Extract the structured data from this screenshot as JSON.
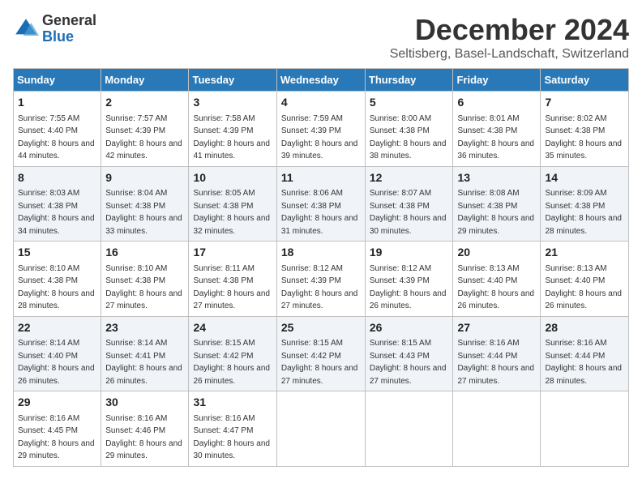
{
  "logo": {
    "general": "General",
    "blue": "Blue"
  },
  "title": "December 2024",
  "subtitle": "Seltisberg, Basel-Landschaft, Switzerland",
  "days_header": [
    "Sunday",
    "Monday",
    "Tuesday",
    "Wednesday",
    "Thursday",
    "Friday",
    "Saturday"
  ],
  "weeks": [
    [
      {
        "day": "1",
        "sunrise": "7:55 AM",
        "sunset": "4:40 PM",
        "daylight": "8 hours and 44 minutes."
      },
      {
        "day": "2",
        "sunrise": "7:57 AM",
        "sunset": "4:39 PM",
        "daylight": "8 hours and 42 minutes."
      },
      {
        "day": "3",
        "sunrise": "7:58 AM",
        "sunset": "4:39 PM",
        "daylight": "8 hours and 41 minutes."
      },
      {
        "day": "4",
        "sunrise": "7:59 AM",
        "sunset": "4:39 PM",
        "daylight": "8 hours and 39 minutes."
      },
      {
        "day": "5",
        "sunrise": "8:00 AM",
        "sunset": "4:38 PM",
        "daylight": "8 hours and 38 minutes."
      },
      {
        "day": "6",
        "sunrise": "8:01 AM",
        "sunset": "4:38 PM",
        "daylight": "8 hours and 36 minutes."
      },
      {
        "day": "7",
        "sunrise": "8:02 AM",
        "sunset": "4:38 PM",
        "daylight": "8 hours and 35 minutes."
      }
    ],
    [
      {
        "day": "8",
        "sunrise": "8:03 AM",
        "sunset": "4:38 PM",
        "daylight": "8 hours and 34 minutes."
      },
      {
        "day": "9",
        "sunrise": "8:04 AM",
        "sunset": "4:38 PM",
        "daylight": "8 hours and 33 minutes."
      },
      {
        "day": "10",
        "sunrise": "8:05 AM",
        "sunset": "4:38 PM",
        "daylight": "8 hours and 32 minutes."
      },
      {
        "day": "11",
        "sunrise": "8:06 AM",
        "sunset": "4:38 PM",
        "daylight": "8 hours and 31 minutes."
      },
      {
        "day": "12",
        "sunrise": "8:07 AM",
        "sunset": "4:38 PM",
        "daylight": "8 hours and 30 minutes."
      },
      {
        "day": "13",
        "sunrise": "8:08 AM",
        "sunset": "4:38 PM",
        "daylight": "8 hours and 29 minutes."
      },
      {
        "day": "14",
        "sunrise": "8:09 AM",
        "sunset": "4:38 PM",
        "daylight": "8 hours and 28 minutes."
      }
    ],
    [
      {
        "day": "15",
        "sunrise": "8:10 AM",
        "sunset": "4:38 PM",
        "daylight": "8 hours and 28 minutes."
      },
      {
        "day": "16",
        "sunrise": "8:10 AM",
        "sunset": "4:38 PM",
        "daylight": "8 hours and 27 minutes."
      },
      {
        "day": "17",
        "sunrise": "8:11 AM",
        "sunset": "4:38 PM",
        "daylight": "8 hours and 27 minutes."
      },
      {
        "day": "18",
        "sunrise": "8:12 AM",
        "sunset": "4:39 PM",
        "daylight": "8 hours and 27 minutes."
      },
      {
        "day": "19",
        "sunrise": "8:12 AM",
        "sunset": "4:39 PM",
        "daylight": "8 hours and 26 minutes."
      },
      {
        "day": "20",
        "sunrise": "8:13 AM",
        "sunset": "4:40 PM",
        "daylight": "8 hours and 26 minutes."
      },
      {
        "day": "21",
        "sunrise": "8:13 AM",
        "sunset": "4:40 PM",
        "daylight": "8 hours and 26 minutes."
      }
    ],
    [
      {
        "day": "22",
        "sunrise": "8:14 AM",
        "sunset": "4:40 PM",
        "daylight": "8 hours and 26 minutes."
      },
      {
        "day": "23",
        "sunrise": "8:14 AM",
        "sunset": "4:41 PM",
        "daylight": "8 hours and 26 minutes."
      },
      {
        "day": "24",
        "sunrise": "8:15 AM",
        "sunset": "4:42 PM",
        "daylight": "8 hours and 26 minutes."
      },
      {
        "day": "25",
        "sunrise": "8:15 AM",
        "sunset": "4:42 PM",
        "daylight": "8 hours and 27 minutes."
      },
      {
        "day": "26",
        "sunrise": "8:15 AM",
        "sunset": "4:43 PM",
        "daylight": "8 hours and 27 minutes."
      },
      {
        "day": "27",
        "sunrise": "8:16 AM",
        "sunset": "4:44 PM",
        "daylight": "8 hours and 27 minutes."
      },
      {
        "day": "28",
        "sunrise": "8:16 AM",
        "sunset": "4:44 PM",
        "daylight": "8 hours and 28 minutes."
      }
    ],
    [
      {
        "day": "29",
        "sunrise": "8:16 AM",
        "sunset": "4:45 PM",
        "daylight": "8 hours and 29 minutes."
      },
      {
        "day": "30",
        "sunrise": "8:16 AM",
        "sunset": "4:46 PM",
        "daylight": "8 hours and 29 minutes."
      },
      {
        "day": "31",
        "sunrise": "8:16 AM",
        "sunset": "4:47 PM",
        "daylight": "8 hours and 30 minutes."
      },
      null,
      null,
      null,
      null
    ]
  ]
}
